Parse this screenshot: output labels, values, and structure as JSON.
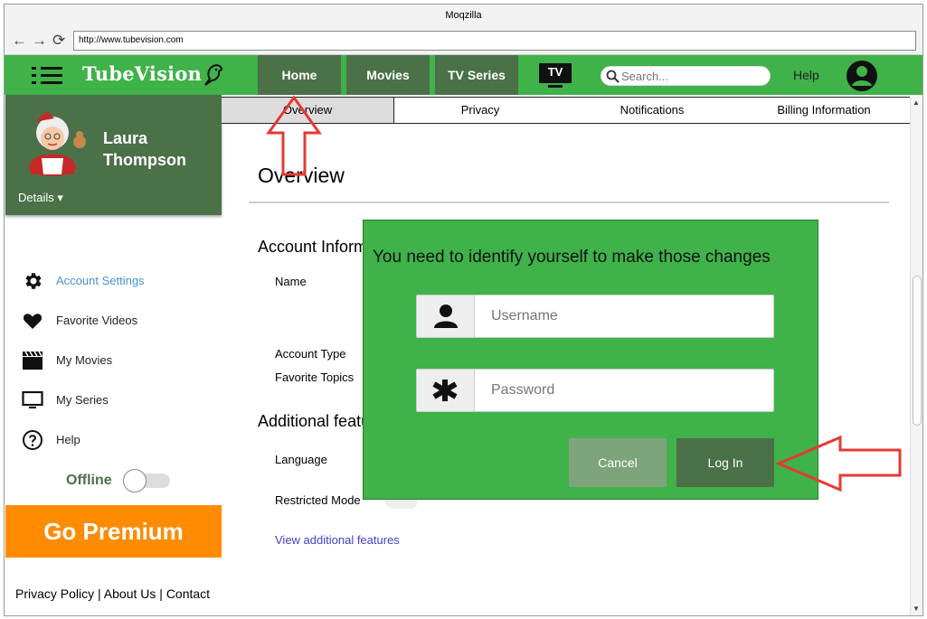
{
  "browser": {
    "title": "Moqzilla",
    "url": "http://www.tubevision.com",
    "back_icon": "arrow-left-icon",
    "forward_icon": "arrow-right-icon",
    "reload_icon": "reload-icon"
  },
  "app": {
    "logo": "TubeVision",
    "nav": [
      "Home",
      "Movies",
      "TV Series"
    ],
    "tv_label": "TV",
    "search_placeholder": "Search...",
    "help": "Help",
    "colors": {
      "primary": "#3fb24a",
      "dark": "#4a7148",
      "premium": "#ff8c00",
      "link": "#4a90d9"
    }
  },
  "profile": {
    "name_first": "Laura",
    "name_last": "Thompson",
    "details": "Details ▾"
  },
  "sidebar": {
    "items": [
      {
        "label": "Account Settings",
        "icon": "gear-icon",
        "active": true
      },
      {
        "label": "Favorite Videos",
        "icon": "heart-icon"
      },
      {
        "label": "My Movies",
        "icon": "clapperboard-icon"
      },
      {
        "label": "My Series",
        "icon": "monitor-icon"
      },
      {
        "label": "Help",
        "icon": "question-circle-icon"
      }
    ],
    "offline_label": "Offline",
    "offline_on": false,
    "premium": "Go Premium",
    "footer": {
      "privacy": "Privacy Policy",
      "about": "About Us",
      "contact": "Contact",
      "sep": "|"
    }
  },
  "tabs": [
    "Overview",
    "Privacy",
    "Notifications",
    "Billing Information"
  ],
  "content": {
    "title": "Overview",
    "account_section": "Account Information",
    "name_label": "Name",
    "account_type_label": "Account Type",
    "favorite_topics_label": "Favorite Topics",
    "additional_section": "Additional features",
    "language_label": "Language",
    "restricted_label": "Restricted Mode",
    "view_more": "View additional features"
  },
  "modal": {
    "message": "You need to identify yourself to make those changes",
    "username_placeholder": "Username",
    "password_placeholder": "Password",
    "cancel": "Cancel",
    "login": "Log In",
    "user_icon": "user-icon",
    "password_icon": "asterisk-icon"
  }
}
